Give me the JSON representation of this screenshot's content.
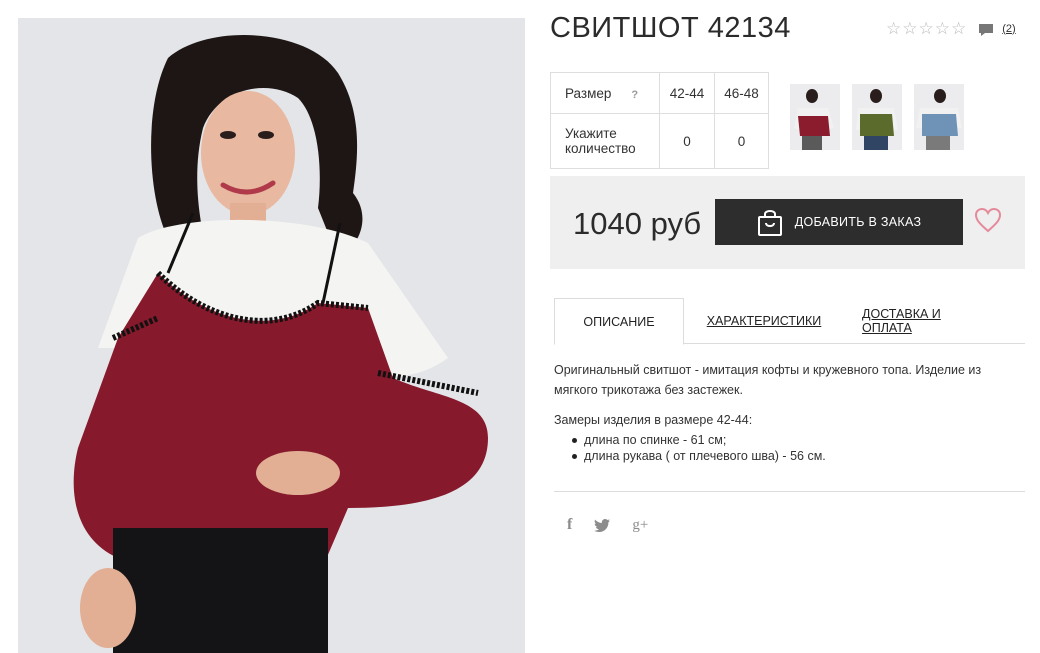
{
  "product": {
    "title": "СВИТШОТ 42134",
    "review_count": "(2)",
    "rating": 0,
    "rating_max": 5
  },
  "sizes": {
    "label": "Размер",
    "help": "?",
    "options": [
      "42-44",
      "46-48"
    ],
    "quantity_label_1": "Укажите",
    "quantity_label_2": "количество",
    "quantities": [
      "0",
      "0"
    ]
  },
  "thumbnails": [
    {
      "name": "burgundy",
      "color": "#8a1c2e"
    },
    {
      "name": "olive",
      "color": "#5b6b2c"
    },
    {
      "name": "blue",
      "color": "#6f93b7"
    }
  ],
  "buy": {
    "price": "1040 руб",
    "add_label": "ДОБАВИТЬ В ЗАКАЗ"
  },
  "tabs": [
    {
      "label": "ОПИСАНИЕ"
    },
    {
      "label": "ХАРАКТЕРИСТИКИ"
    },
    {
      "label": "ДОСТАВКА И ОПЛАТА"
    }
  ],
  "description": {
    "text": "Оригинальный свитшот - имитация кофты и кружевного топа. Изделие из мягкого трикотажа без застежек.",
    "measurements_title": "Замеры изделия в размере 42-44:",
    "measurements": [
      "длина по спинке - 61 см;",
      "длина рукава ( от плечевого шва) - 56 см."
    ]
  },
  "social": {
    "facebook": "f",
    "twitter": "🐦",
    "google": "g+"
  },
  "colors": {
    "accent_heart": "#e58a9b",
    "button_bg": "#2d2d2d",
    "buybox_bg": "#efefef"
  }
}
